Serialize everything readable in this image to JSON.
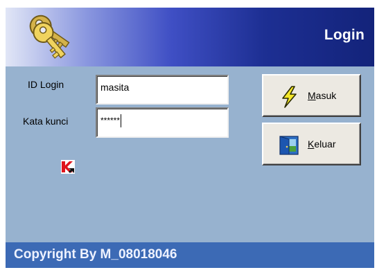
{
  "header": {
    "title": "Login",
    "icon": "keys-icon"
  },
  "form": {
    "id_label": "ID Login",
    "id_value": "masita",
    "password_label": "Kata kunci",
    "password_value": "******"
  },
  "buttons": {
    "masuk": {
      "label_prefix": "",
      "mnemonic": "M",
      "label_rest": "asuk",
      "icon": "lightning-icon"
    },
    "keluar": {
      "label_prefix": "",
      "mnemonic": "K",
      "label_rest": "eluar",
      "icon": "exit-door-icon"
    }
  },
  "tray_icon": "kaspersky-icon",
  "footer": {
    "text": "Copyright By M_08018046"
  },
  "colors": {
    "body": "#97b2cf",
    "footer": "#3c6ab5",
    "header_dark": "#13237a"
  }
}
